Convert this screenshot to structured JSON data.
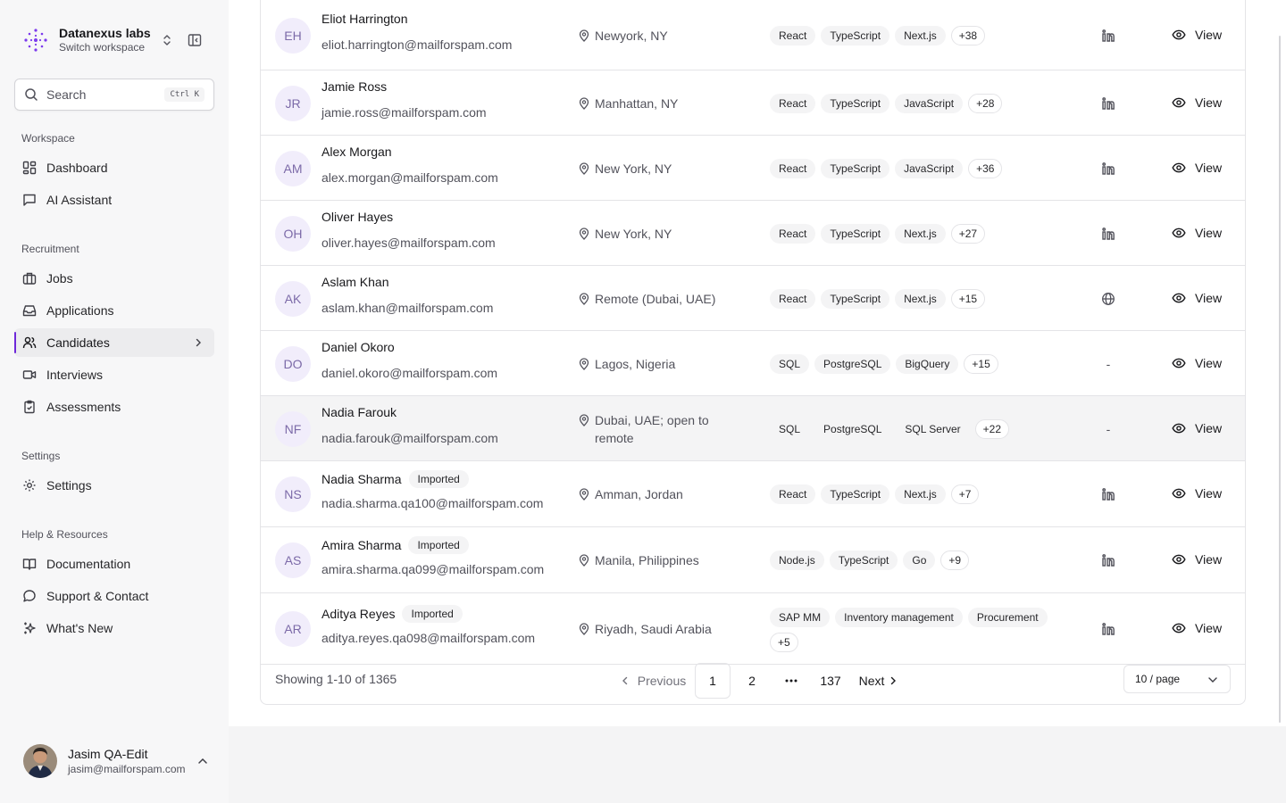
{
  "workspace": {
    "name": "Datanexus labs",
    "subtitle": "Switch workspace"
  },
  "search": {
    "placeholder": "Search",
    "shortcut": "Ctrl K"
  },
  "sections": {
    "workspace": "Workspace",
    "recruitment": "Recruitment",
    "settings": "Settings",
    "help": "Help & Resources"
  },
  "nav": {
    "dashboard": "Dashboard",
    "ai_assistant": "AI Assistant",
    "jobs": "Jobs",
    "applications": "Applications",
    "candidates": "Candidates",
    "interviews": "Interviews",
    "assessments": "Assessments",
    "settings": "Settings",
    "documentation": "Documentation",
    "support": "Support & Contact",
    "whats_new": "What's New"
  },
  "user": {
    "name": "Jasim QA-Edit",
    "email": "jasim@mailforspam.com"
  },
  "candidates": [
    {
      "initials": "EH",
      "name": "Eliot Harrington",
      "email": "eliot.harrington@mailforspam.com",
      "imported": "",
      "location": "Newyork, NY",
      "tags": [
        "React",
        "TypeScript",
        "Next.js"
      ],
      "more": "+38",
      "social": "linkedin"
    },
    {
      "initials": "JR",
      "name": "Jamie Ross",
      "email": "jamie.ross@mailforspam.com",
      "imported": "",
      "location": "Manhattan, NY",
      "tags": [
        "React",
        "TypeScript",
        "JavaScript"
      ],
      "more": "+28",
      "social": "linkedin"
    },
    {
      "initials": "AM",
      "name": "Alex Morgan",
      "email": "alex.morgan@mailforspam.com",
      "imported": "",
      "location": "New York, NY",
      "tags": [
        "React",
        "TypeScript",
        "JavaScript"
      ],
      "more": "+36",
      "social": "linkedin"
    },
    {
      "initials": "OH",
      "name": "Oliver Hayes",
      "email": "oliver.hayes@mailforspam.com",
      "imported": "",
      "location": "New York, NY",
      "tags": [
        "React",
        "TypeScript",
        "Next.js"
      ],
      "more": "+27",
      "social": "linkedin"
    },
    {
      "initials": "AK",
      "name": "Aslam Khan",
      "email": "aslam.khan@mailforspam.com",
      "imported": "",
      "location": "Remote (Dubai, UAE)",
      "tags": [
        "React",
        "TypeScript",
        "Next.js"
      ],
      "more": "+15",
      "social": "globe"
    },
    {
      "initials": "DO",
      "name": "Daniel Okoro",
      "email": "daniel.okoro@mailforspam.com",
      "imported": "",
      "location": "Lagos, Nigeria",
      "tags": [
        "SQL",
        "PostgreSQL",
        "BigQuery"
      ],
      "more": "+15",
      "social": "-"
    },
    {
      "initials": "NF",
      "name": "Nadia Farouk",
      "email": "nadia.farouk@mailforspam.com",
      "imported": "",
      "location": "Dubai, UAE; open to remote",
      "tags": [
        "SQL",
        "PostgreSQL",
        "SQL Server"
      ],
      "more": "+22",
      "social": "-"
    },
    {
      "initials": "NS",
      "name": "Nadia Sharma",
      "email": "nadia.sharma.qa100@mailforspam.com",
      "imported": "Imported",
      "location": "Amman, Jordan",
      "tags": [
        "React",
        "TypeScript",
        "Next.js"
      ],
      "more": "+7",
      "social": "linkedin"
    },
    {
      "initials": "AS",
      "name": "Amira Sharma",
      "email": "amira.sharma.qa099@mailforspam.com",
      "imported": "Imported",
      "location": "Manila, Philippines",
      "tags": [
        "Node.js",
        "TypeScript",
        "Go"
      ],
      "more": "+9",
      "social": "linkedin"
    },
    {
      "initials": "AR",
      "name": "Aditya Reyes",
      "email": "aditya.reyes.qa098@mailforspam.com",
      "imported": "Imported",
      "location": "Riyadh, Saudi Arabia",
      "tags": [
        "SAP MM",
        "Inventory management",
        "Procurement"
      ],
      "more": "+5",
      "social": "linkedin"
    }
  ],
  "view_label": "View",
  "pagination": {
    "showing": "Showing 1-10 of 1365",
    "previous": "Previous",
    "pages": [
      "1",
      "2"
    ],
    "ellipsis": "···",
    "last": "137",
    "next": "Next",
    "current": "1",
    "page_size": "10 / page"
  },
  "colors": {
    "accent": "#6d28d9",
    "avatar_bg": "#f1edfb",
    "avatar_text": "#7c6aa8"
  }
}
